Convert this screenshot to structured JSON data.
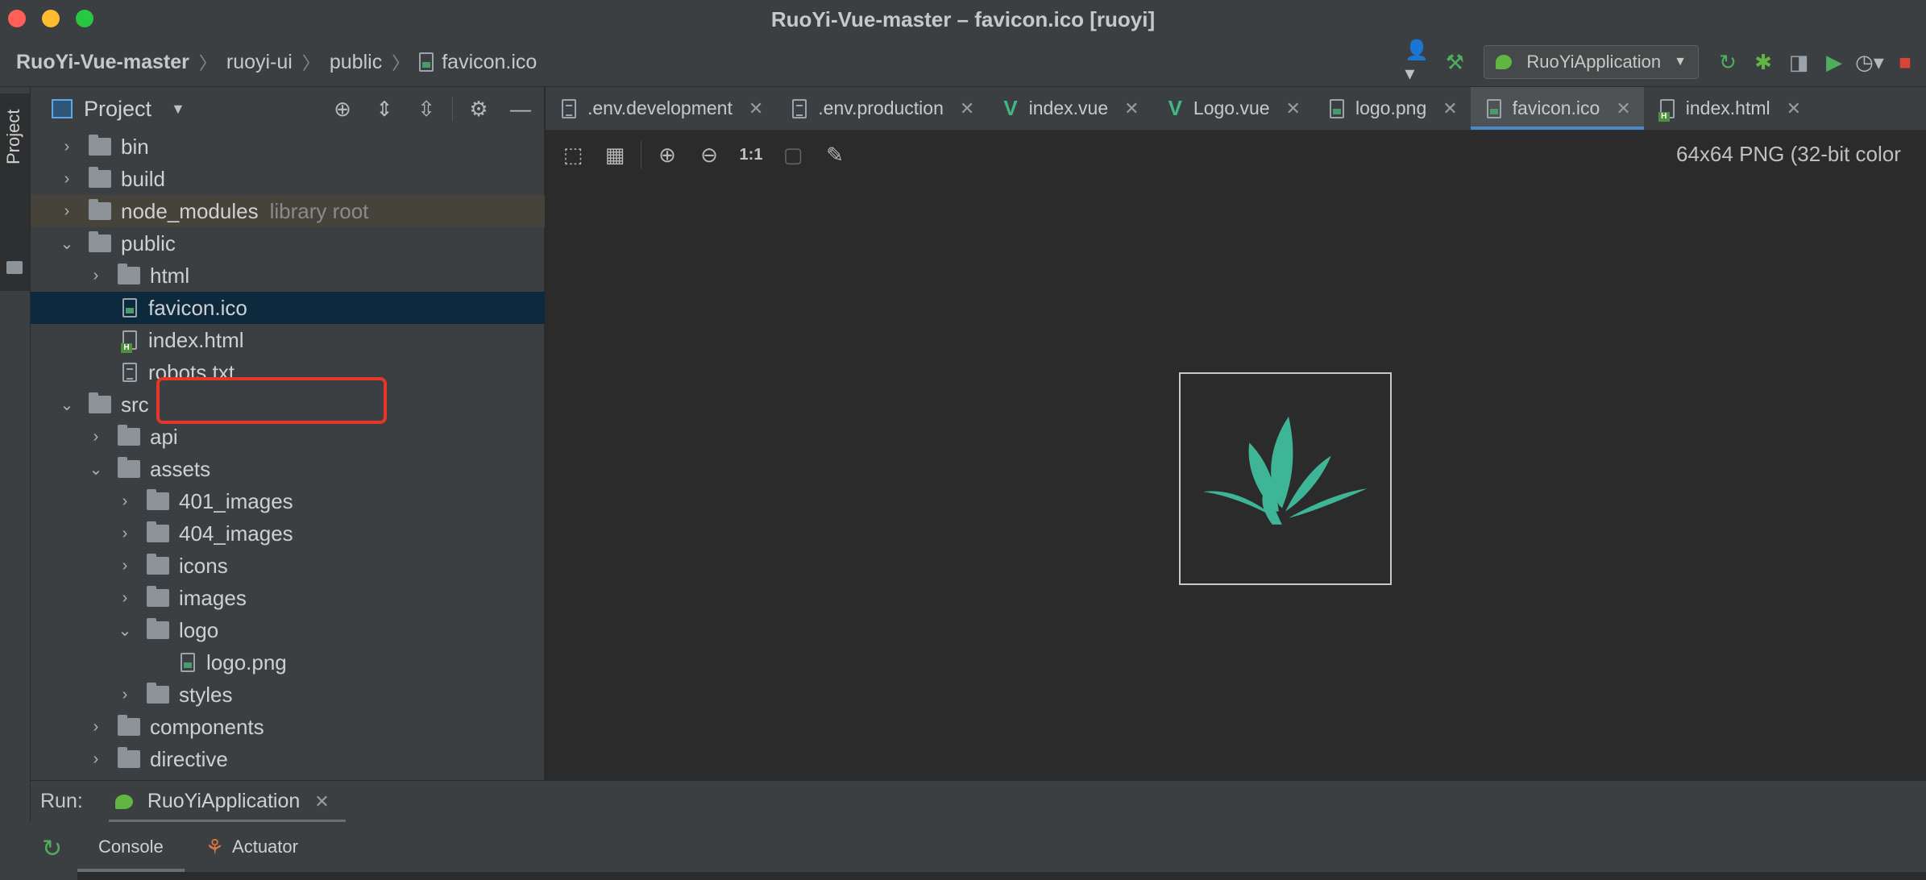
{
  "window": {
    "title": "RuoYi-Vue-master – favicon.ico [ruoyi]"
  },
  "breadcrumb": [
    "RuoYi-Vue-master",
    "ruoyi-ui",
    "public",
    "favicon.ico"
  ],
  "run_config": {
    "label": "RuoYiApplication"
  },
  "toolstrip": {
    "project_label": "Project"
  },
  "project_panel": {
    "title": "Project",
    "tree": [
      {
        "name": "bin",
        "type": "folder",
        "depth": 0,
        "expanded": false
      },
      {
        "name": "build",
        "type": "folder",
        "depth": 0,
        "expanded": false
      },
      {
        "name": "node_modules",
        "type": "folder",
        "depth": 0,
        "expanded": false,
        "note": "library root"
      },
      {
        "name": "public",
        "type": "folder",
        "depth": 0,
        "expanded": true
      },
      {
        "name": "html",
        "type": "folder",
        "depth": 1,
        "expanded": false
      },
      {
        "name": "favicon.ico",
        "type": "image",
        "depth": 1,
        "selected": true
      },
      {
        "name": "index.html",
        "type": "html",
        "depth": 1
      },
      {
        "name": "robots.txt",
        "type": "text",
        "depth": 1
      },
      {
        "name": "src",
        "type": "folder",
        "depth": 0,
        "expanded": true
      },
      {
        "name": "api",
        "type": "folder",
        "depth": 1,
        "expanded": false
      },
      {
        "name": "assets",
        "type": "folder",
        "depth": 1,
        "expanded": true
      },
      {
        "name": "401_images",
        "type": "folder",
        "depth": 2,
        "expanded": false
      },
      {
        "name": "404_images",
        "type": "folder",
        "depth": 2,
        "expanded": false
      },
      {
        "name": "icons",
        "type": "folder",
        "depth": 2,
        "expanded": false
      },
      {
        "name": "images",
        "type": "folder",
        "depth": 2,
        "expanded": false
      },
      {
        "name": "logo",
        "type": "folder",
        "depth": 2,
        "expanded": true
      },
      {
        "name": "logo.png",
        "type": "image",
        "depth": 3
      },
      {
        "name": "styles",
        "type": "folder",
        "depth": 2,
        "expanded": false
      },
      {
        "name": "components",
        "type": "folder",
        "depth": 1,
        "expanded": false
      },
      {
        "name": "directive",
        "type": "folder",
        "depth": 1,
        "expanded": false
      }
    ]
  },
  "editor_tabs": [
    {
      "label": ".env.development",
      "icon": "text",
      "active": false
    },
    {
      "label": ".env.production",
      "icon": "text",
      "active": false
    },
    {
      "label": "index.vue",
      "icon": "vue",
      "active": false
    },
    {
      "label": "Logo.vue",
      "icon": "vue",
      "active": false
    },
    {
      "label": "logo.png",
      "icon": "image",
      "active": false
    },
    {
      "label": "favicon.ico",
      "icon": "image",
      "active": true
    },
    {
      "label": "index.html",
      "icon": "html",
      "active": false
    }
  ],
  "image_viewer": {
    "ratio_label": "1:1",
    "info": "64x64 PNG (32-bit color",
    "logo_color": "#3fb597"
  },
  "run_panel": {
    "label": "Run:",
    "tab_label": "RuoYiApplication",
    "console_tab": "Console",
    "actuator_tab": "Actuator"
  },
  "colors": {
    "accent": "#4a88c7",
    "selection": "#0d293e",
    "highlight_box": "#e53627",
    "traffic_close": "#ff5f57",
    "traffic_min": "#febc2e",
    "traffic_max": "#28c840"
  }
}
